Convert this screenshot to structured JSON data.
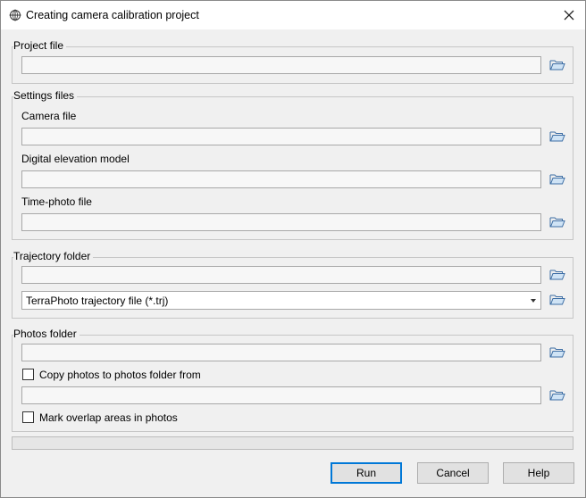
{
  "window": {
    "title": "Creating camera calibration project",
    "close_icon": "close-icon",
    "app_icon": "crosshair-globe-icon"
  },
  "project_file": {
    "group_title": "Project file",
    "value": ""
  },
  "settings_files": {
    "group_title": "Settings files",
    "camera_label": "Camera file",
    "camera_value": "",
    "dem_label": "Digital elevation model",
    "dem_value": "",
    "timephoto_label": "Time-photo file",
    "timephoto_value": ""
  },
  "trajectory_folder": {
    "group_title": "Trajectory folder",
    "value": "",
    "format_selected": "TerraPhoto trajectory file (*.trj)"
  },
  "photos_folder": {
    "group_title": "Photos folder",
    "value": "",
    "copy_label": "Copy photos to photos folder from",
    "copy_checked": false,
    "copy_from_value": "",
    "overlap_label": "Mark overlap areas in photos",
    "overlap_checked": false
  },
  "progress": {
    "value": 0
  },
  "buttons": {
    "run": "Run",
    "cancel": "Cancel",
    "help": "Help"
  },
  "colors": {
    "folder_icon": "#4a86c8",
    "default_button_border": "#0078d7",
    "dialog_bg": "#f0f0f0"
  }
}
